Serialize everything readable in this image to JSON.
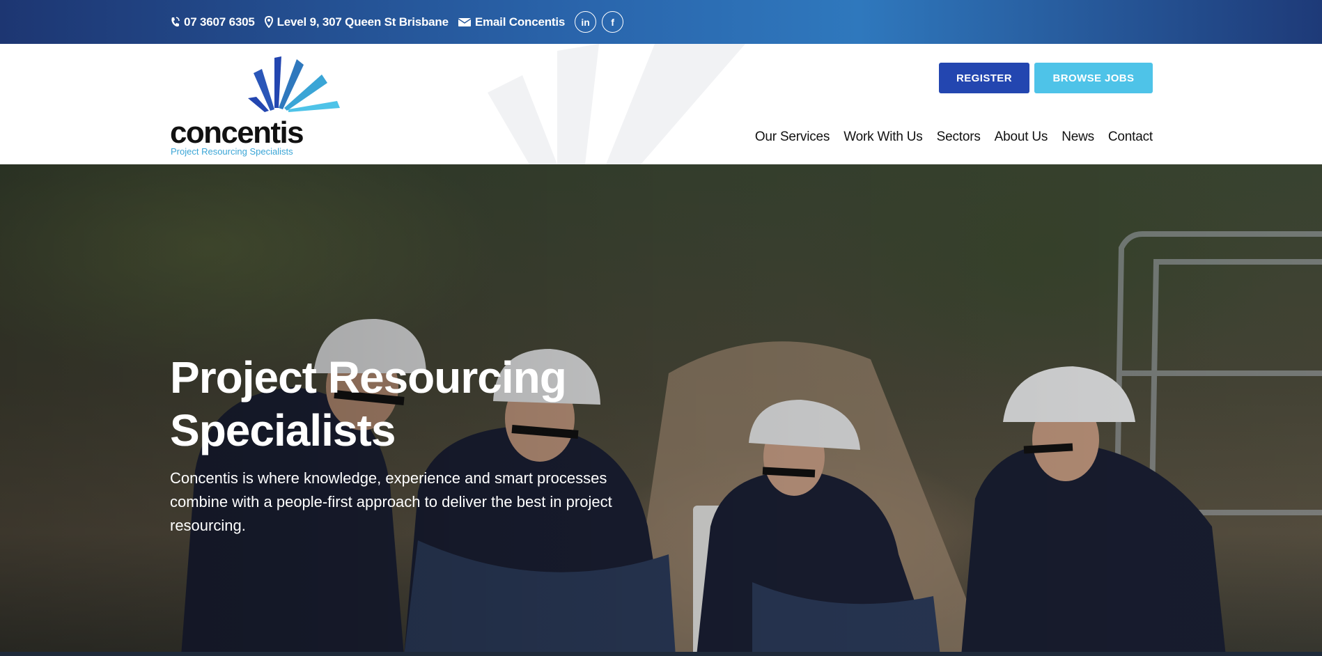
{
  "topbar": {
    "phone": "07 3607 6305",
    "address": "Level 9, 307 Queen St Brisbane",
    "email_label": "Email Concentis",
    "social": [
      {
        "icon": "linkedin-icon",
        "label": "in"
      },
      {
        "icon": "facebook-icon",
        "label": "f"
      }
    ]
  },
  "logo": {
    "wordmark": "concentis",
    "tagline": "Project Resourcing Specialists"
  },
  "header_buttons": {
    "register": "REGISTER",
    "browse_jobs": "BROWSE JOBS"
  },
  "nav": {
    "items": [
      "Our Services",
      "Work With Us",
      "Sectors",
      "About Us",
      "News",
      "Contact"
    ]
  },
  "hero": {
    "title": "Project Resourcing Specialists",
    "body": "Concentis is where knowledge, experience and smart processes combine with a people-first approach to deliver the best in project resourcing."
  },
  "colors": {
    "brand_dark_blue": "#1d3672",
    "brand_blue": "#2346b0",
    "brand_light_blue": "#4ec3e8",
    "tagline_blue": "#3aa5d6"
  }
}
